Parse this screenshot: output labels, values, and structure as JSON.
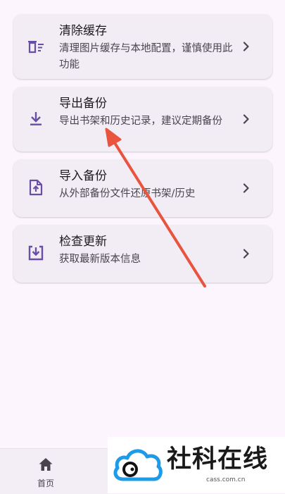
{
  "settings": [
    {
      "title": "清除缓存",
      "desc": "清理图片缓存与本地配置，谨慎使用此功能",
      "icon": "clear-cache-icon"
    },
    {
      "title": "导出备份",
      "desc": "导出书架和历史记录，建议定期备份",
      "icon": "download-icon"
    },
    {
      "title": "导入备份",
      "desc": "从外部备份文件还原书架/历史",
      "icon": "file-upload-icon"
    },
    {
      "title": "检查更新",
      "desc": "获取最新版本信息",
      "icon": "update-check-icon"
    }
  ],
  "bottom_nav": {
    "home_label": "首页"
  },
  "watermark": {
    "name": "社科在线",
    "url": "cass.com.cn"
  },
  "colors": {
    "background": "#fcf5fd",
    "card": "#f2ecf4",
    "icon_accent": "#6750a4",
    "annotation_arrow": "#e8543e",
    "logo_blue": "#1e9be8"
  }
}
